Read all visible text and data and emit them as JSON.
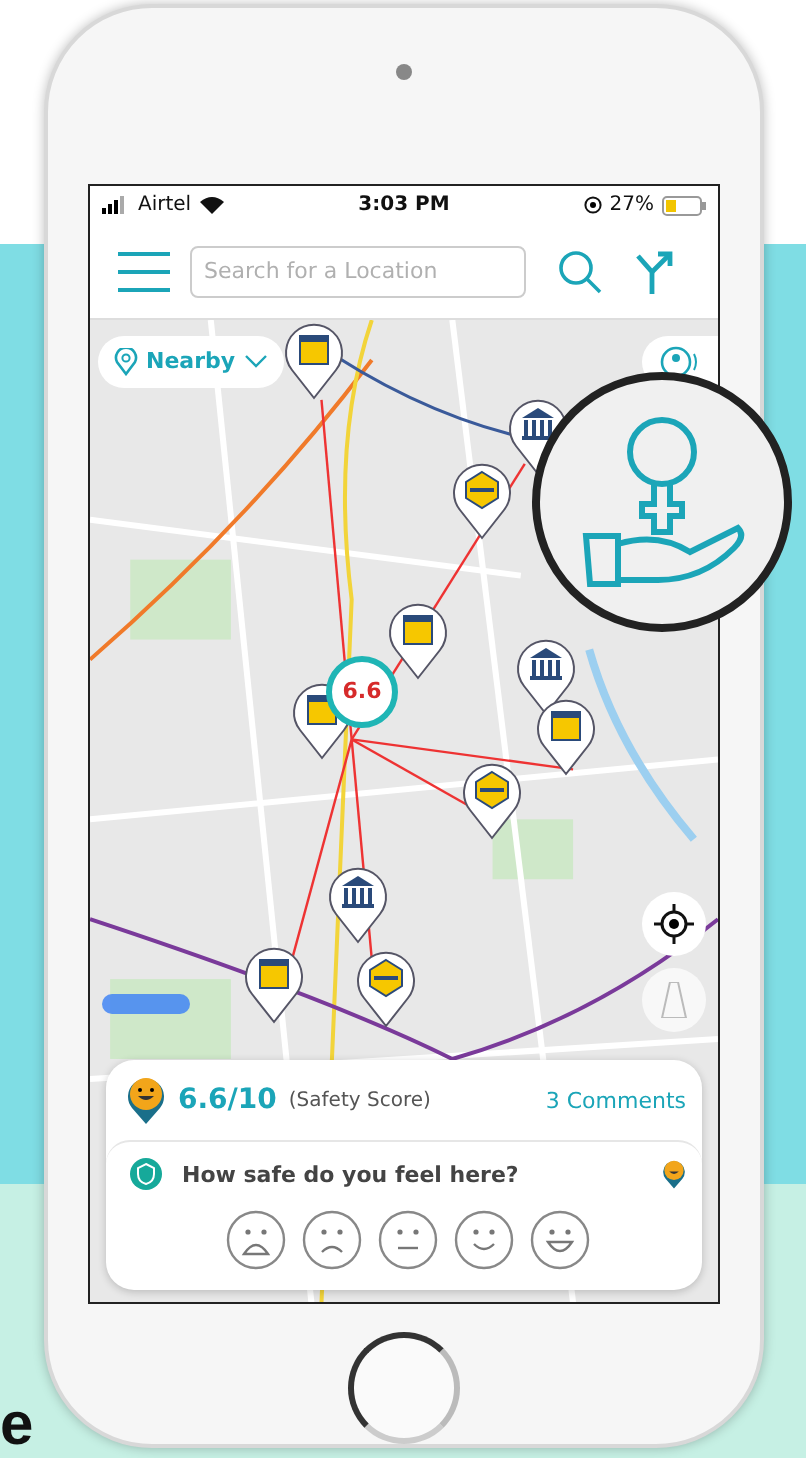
{
  "status_bar": {
    "carrier": "Airtel",
    "time": "3:03 PM",
    "battery": "27%"
  },
  "header": {
    "search": {
      "placeholder": "Search for a Location"
    }
  },
  "map": {
    "nearby_button": "Nearby",
    "score_marker": "6.6"
  },
  "score_card": {
    "score": "6.6/10",
    "score_label": "(Safety Score)",
    "comments": "3 Comments"
  },
  "feedback": {
    "question": "How safe do you feel here?",
    "faces": [
      {
        "kind": "crying"
      },
      {
        "kind": "sad"
      },
      {
        "kind": "neutral"
      },
      {
        "kind": "smile"
      },
      {
        "kind": "laugh"
      }
    ]
  },
  "caption_fragment": "e"
}
